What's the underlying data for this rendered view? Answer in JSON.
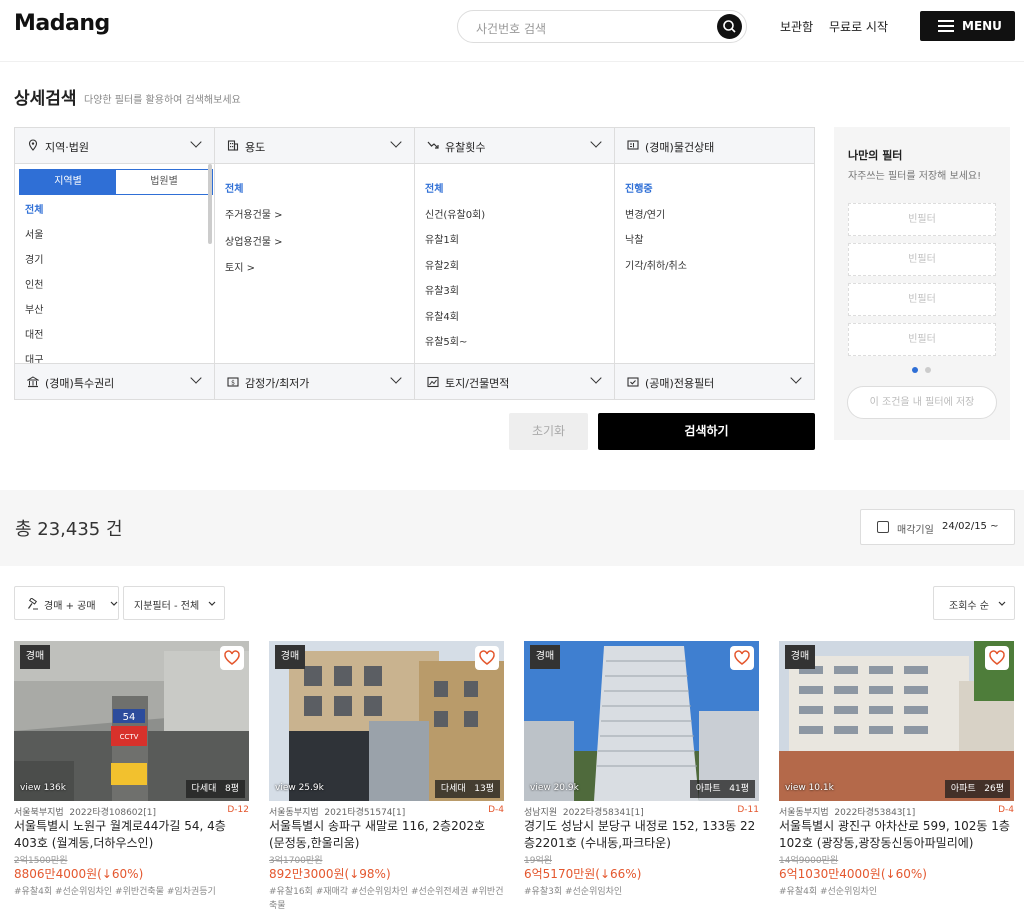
{
  "header": {
    "logo": "Madang",
    "search_placeholder": "사건번호 검색",
    "nav": [
      "보관함",
      "무료로 시작"
    ],
    "menu_label": "MENU"
  },
  "page": {
    "title": "상세검색",
    "subtitle": "다양한 필터를 활용하여 검색해보세요"
  },
  "filters": {
    "headers": [
      "지역·법원",
      "용도",
      "유찰횟수",
      "(경매)물건상태"
    ],
    "region_tabs": [
      "지역별",
      "법원별"
    ],
    "regions": [
      "전체",
      "서울",
      "경기",
      "인천",
      "부산",
      "대전",
      "대구"
    ],
    "usage": [
      "전체",
      "주거용건물 >",
      "상업용건물 >",
      "토지 >"
    ],
    "failed_bids": [
      "전체",
      "신건(유찰0회)",
      "유찰1회",
      "유찰2회",
      "유찰3회",
      "유찰4회",
      "유찰5회~"
    ],
    "status": [
      "진행중",
      "변경/연기",
      "낙찰",
      "기각/취하/취소"
    ],
    "bottom": [
      "(경매)특수권리",
      "감정가/최저가",
      "토지/건물면적",
      "(공매)전용필터"
    ],
    "reset_label": "초기화",
    "search_label": "검색하기"
  },
  "my_filter": {
    "title": "나만의 필터",
    "subtitle": "자주쓰는 필터를 저장해 보세요!",
    "slots": [
      "빈필터",
      "빈필터",
      "빈필터",
      "빈필터"
    ],
    "save_label": "이 조건을 내 필터에 저장"
  },
  "results": {
    "total": "총 23,435 건",
    "date_label": "매각기일",
    "date_value": "24/02/15 ~",
    "chips": [
      "경매 + 공매",
      "지분필터 - 전체"
    ],
    "sort": "조회수 순"
  },
  "cards": [
    {
      "type": "경매",
      "views": "view 136k",
      "kind": "다세대",
      "area": "8평",
      "court": "서울북부지법",
      "case": "2022타경108602[1]",
      "dday": "D-12",
      "addr": "서울특별시 노원구 월계로44가길 54, 4층 403호 (월계동,더하우스인)",
      "orig": "2억1500만원",
      "price": "8806만4000원",
      "rate": "(↓60%)",
      "tags": "#유찰4회 #선순위임차인 #위반건축물 #임차권등기"
    },
    {
      "type": "경매",
      "views": "view 25.9k",
      "kind": "다세대",
      "area": "13평",
      "court": "서울동부지법",
      "case": "2021타경51574[1]",
      "dday": "D-4",
      "addr": "서울특별시 송파구 새말로 116, 2층202호 (문정동,한울리움)",
      "orig": "3억1700만원",
      "price": "892만3000원",
      "rate": "(↓98%)",
      "tags": "#유찰16회 #재매각 #선순위임차인 #선순위전세권 #위반건축물"
    },
    {
      "type": "경매",
      "views": "view 20.9k",
      "kind": "아파트",
      "area": "41평",
      "court": "성남지원",
      "case": "2022타경58341[1]",
      "dday": "D-11",
      "addr": "경기도 성남시 분당구 내정로 152, 133동 22층2201호 (수내동,파크타운)",
      "orig": "19억원",
      "price": "6억5170만원",
      "rate": "(↓66%)",
      "tags": "#유찰3회 #선순위임차인"
    },
    {
      "type": "경매",
      "views": "view 10.1k",
      "kind": "아파트",
      "area": "26평",
      "court": "서울동부지법",
      "case": "2022타경53843[1]",
      "dday": "D-4",
      "addr": "서울특별시 광진구 아차산로 599, 102동 1층 102호 (광장동,광장동신동아파밀리에)",
      "orig": "14억9000만원",
      "price": "6억1030만4000원",
      "rate": "(↓60%)",
      "tags": "#유찰4회 #선순위임차인"
    }
  ],
  "colors": {
    "accent": "#2f6fd6",
    "price": "#e4572e",
    "dark": "#111111"
  }
}
